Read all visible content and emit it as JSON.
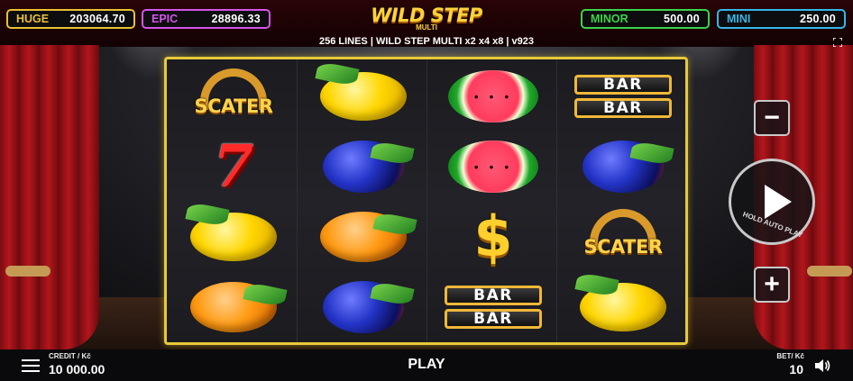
{
  "jackpots": [
    {
      "label": "HUGE",
      "value": "203064.70",
      "color": "#e8c233",
      "name": "jackpot-huge"
    },
    {
      "label": "EPIC",
      "value": "28896.33",
      "color": "#d455e8",
      "name": "jackpot-epic"
    },
    {
      "label": "MINOR",
      "value": "500.00",
      "color": "#3ed24a",
      "name": "jackpot-minor"
    },
    {
      "label": "MINI",
      "value": "250.00",
      "color": "#37b6e8",
      "name": "jackpot-mini"
    }
  ],
  "logo": {
    "title": "WILD STEP",
    "subtitle": "MULTI"
  },
  "info": "256 LINES  |  WILD STEP MULTI x2 x4 x8  |  v923",
  "reels": [
    [
      "scatter",
      "seven",
      "lemon",
      "orange"
    ],
    [
      "lemon",
      "plum",
      "orange",
      "plum"
    ],
    [
      "watermelon",
      "watermelon",
      "dollar",
      "bar"
    ],
    [
      "bar",
      "plum",
      "scatter",
      "lemon"
    ]
  ],
  "symbol_text": {
    "scatter": "SCATER",
    "bar": "BAR",
    "seven": "7",
    "dollar": "$"
  },
  "controls": {
    "minus": "−",
    "plus": "+",
    "hold_auto_play": "HOLD AUTO PLAY"
  },
  "bottom": {
    "credit_label": "CREDIT / Kč",
    "credit_value": "10 000.00",
    "play_label": "PLAY",
    "bet_label": "BET/ Kč",
    "bet_value": "10"
  },
  "icons": {
    "menu": "hamburger-icon",
    "sound": "speaker-icon",
    "fullscreen": "fullscreen-icon"
  },
  "colors": {
    "reel_border": "#e7c93a",
    "background": "#0b0b0e"
  }
}
